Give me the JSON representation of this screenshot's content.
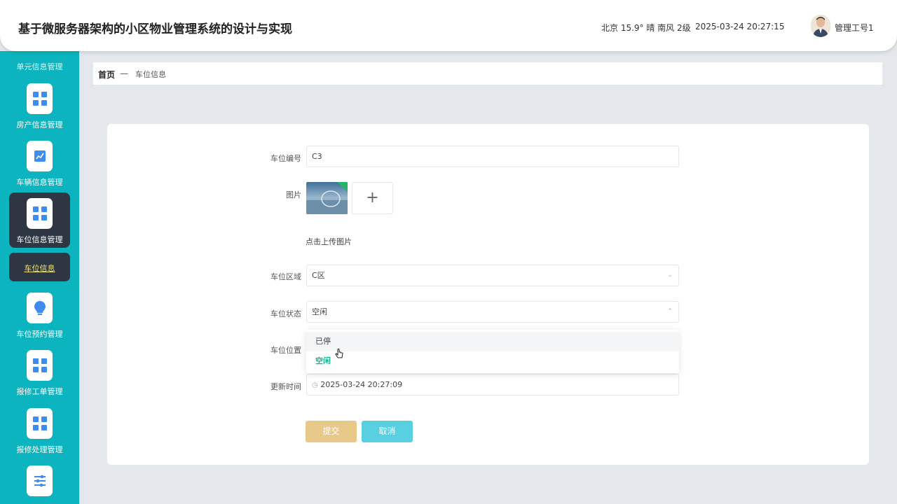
{
  "header": {
    "title": "基于微服务器架构的小区物业管理系统的设计与实现",
    "weather": "北京 15.9° 晴 南风 2级",
    "datetime": "2025-03-24 20:27:15",
    "username": "管理工号1"
  },
  "sidebar": {
    "partial_top_label": "单元信息管理",
    "items": [
      {
        "label": "房产信息管理",
        "icon": "grid-icon"
      },
      {
        "label": "车辆信息管理",
        "icon": "chart-icon"
      },
      {
        "label": "车位信息管理",
        "icon": "grid-icon"
      },
      {
        "label": "车位预约管理",
        "icon": "bulb-icon"
      },
      {
        "label": "报修工单管理",
        "icon": "grid-icon"
      },
      {
        "label": "报修处理管理",
        "icon": "grid-icon"
      },
      {
        "label": "",
        "icon": "sliders-icon"
      }
    ],
    "active_sub": "车位信息"
  },
  "breadcrumb": {
    "home": "首页",
    "separator": "—",
    "current": "车位信息"
  },
  "form": {
    "code_label": "车位编号",
    "code_value": "C3",
    "image_label": "图片",
    "upload_plus": "+",
    "upload_hint": "点击上传图片",
    "area_label": "车位区域",
    "area_value": "C区",
    "status_label": "车位状态",
    "status_value": "空闲",
    "status_options": [
      "已停",
      "空闲"
    ],
    "position_label": "车位位置",
    "update_label": "更新时间",
    "update_value": "2025-03-24 20:27:09",
    "submit": "提交",
    "cancel": "取消"
  },
  "colors": {
    "sidebar": "#0bb4bf",
    "active": "#2e3644",
    "accent": "#14b88e",
    "submit": "#e8c98a",
    "cancel": "#58d0e2"
  }
}
